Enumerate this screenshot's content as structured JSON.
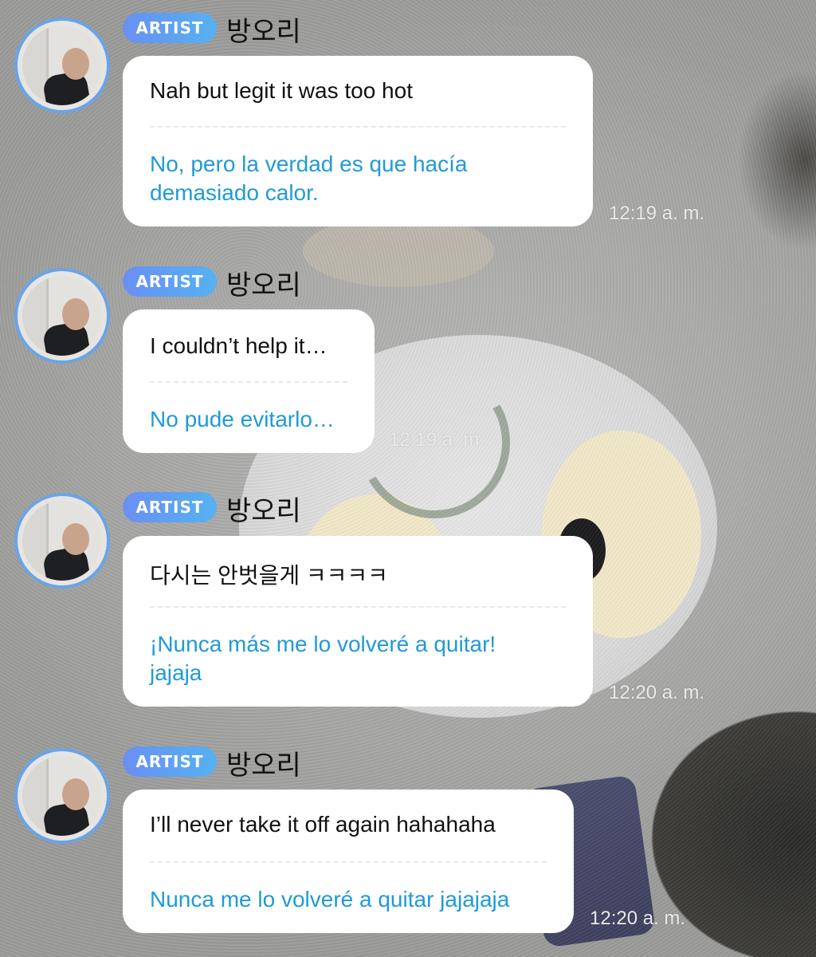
{
  "messages": [
    {
      "badge": "ARTIST",
      "sender": "방오리",
      "original": "Nah but legit it was too hot",
      "translation": "No, pero la verdad es que hacía demasiado calor.",
      "time": "12:19 a. m."
    },
    {
      "badge": "ARTIST",
      "sender": "방오리",
      "original": "I couldn’t help it…",
      "translation": "No pude evitarlo…",
      "time": "12:19 a. m."
    },
    {
      "badge": "ARTIST",
      "sender": "방오리",
      "original": "다시는 안벗을게 ㅋㅋㅋㅋ",
      "translation": "¡Nunca más me lo volveré a quitar! jajaja",
      "time": "12:20 a. m."
    },
    {
      "badge": "ARTIST",
      "sender": "방오리",
      "original": "I’ll never take it off again hahahaha",
      "translation": "Nunca me lo volveré a quitar jajajaja",
      "time": "12:20 a. m."
    }
  ],
  "colors": {
    "badge_gradient_start": "#6a8ff3",
    "badge_gradient_end": "#55b2f2",
    "translation_text": "#1f9ad8",
    "avatar_ring": "#6aa4e8"
  }
}
